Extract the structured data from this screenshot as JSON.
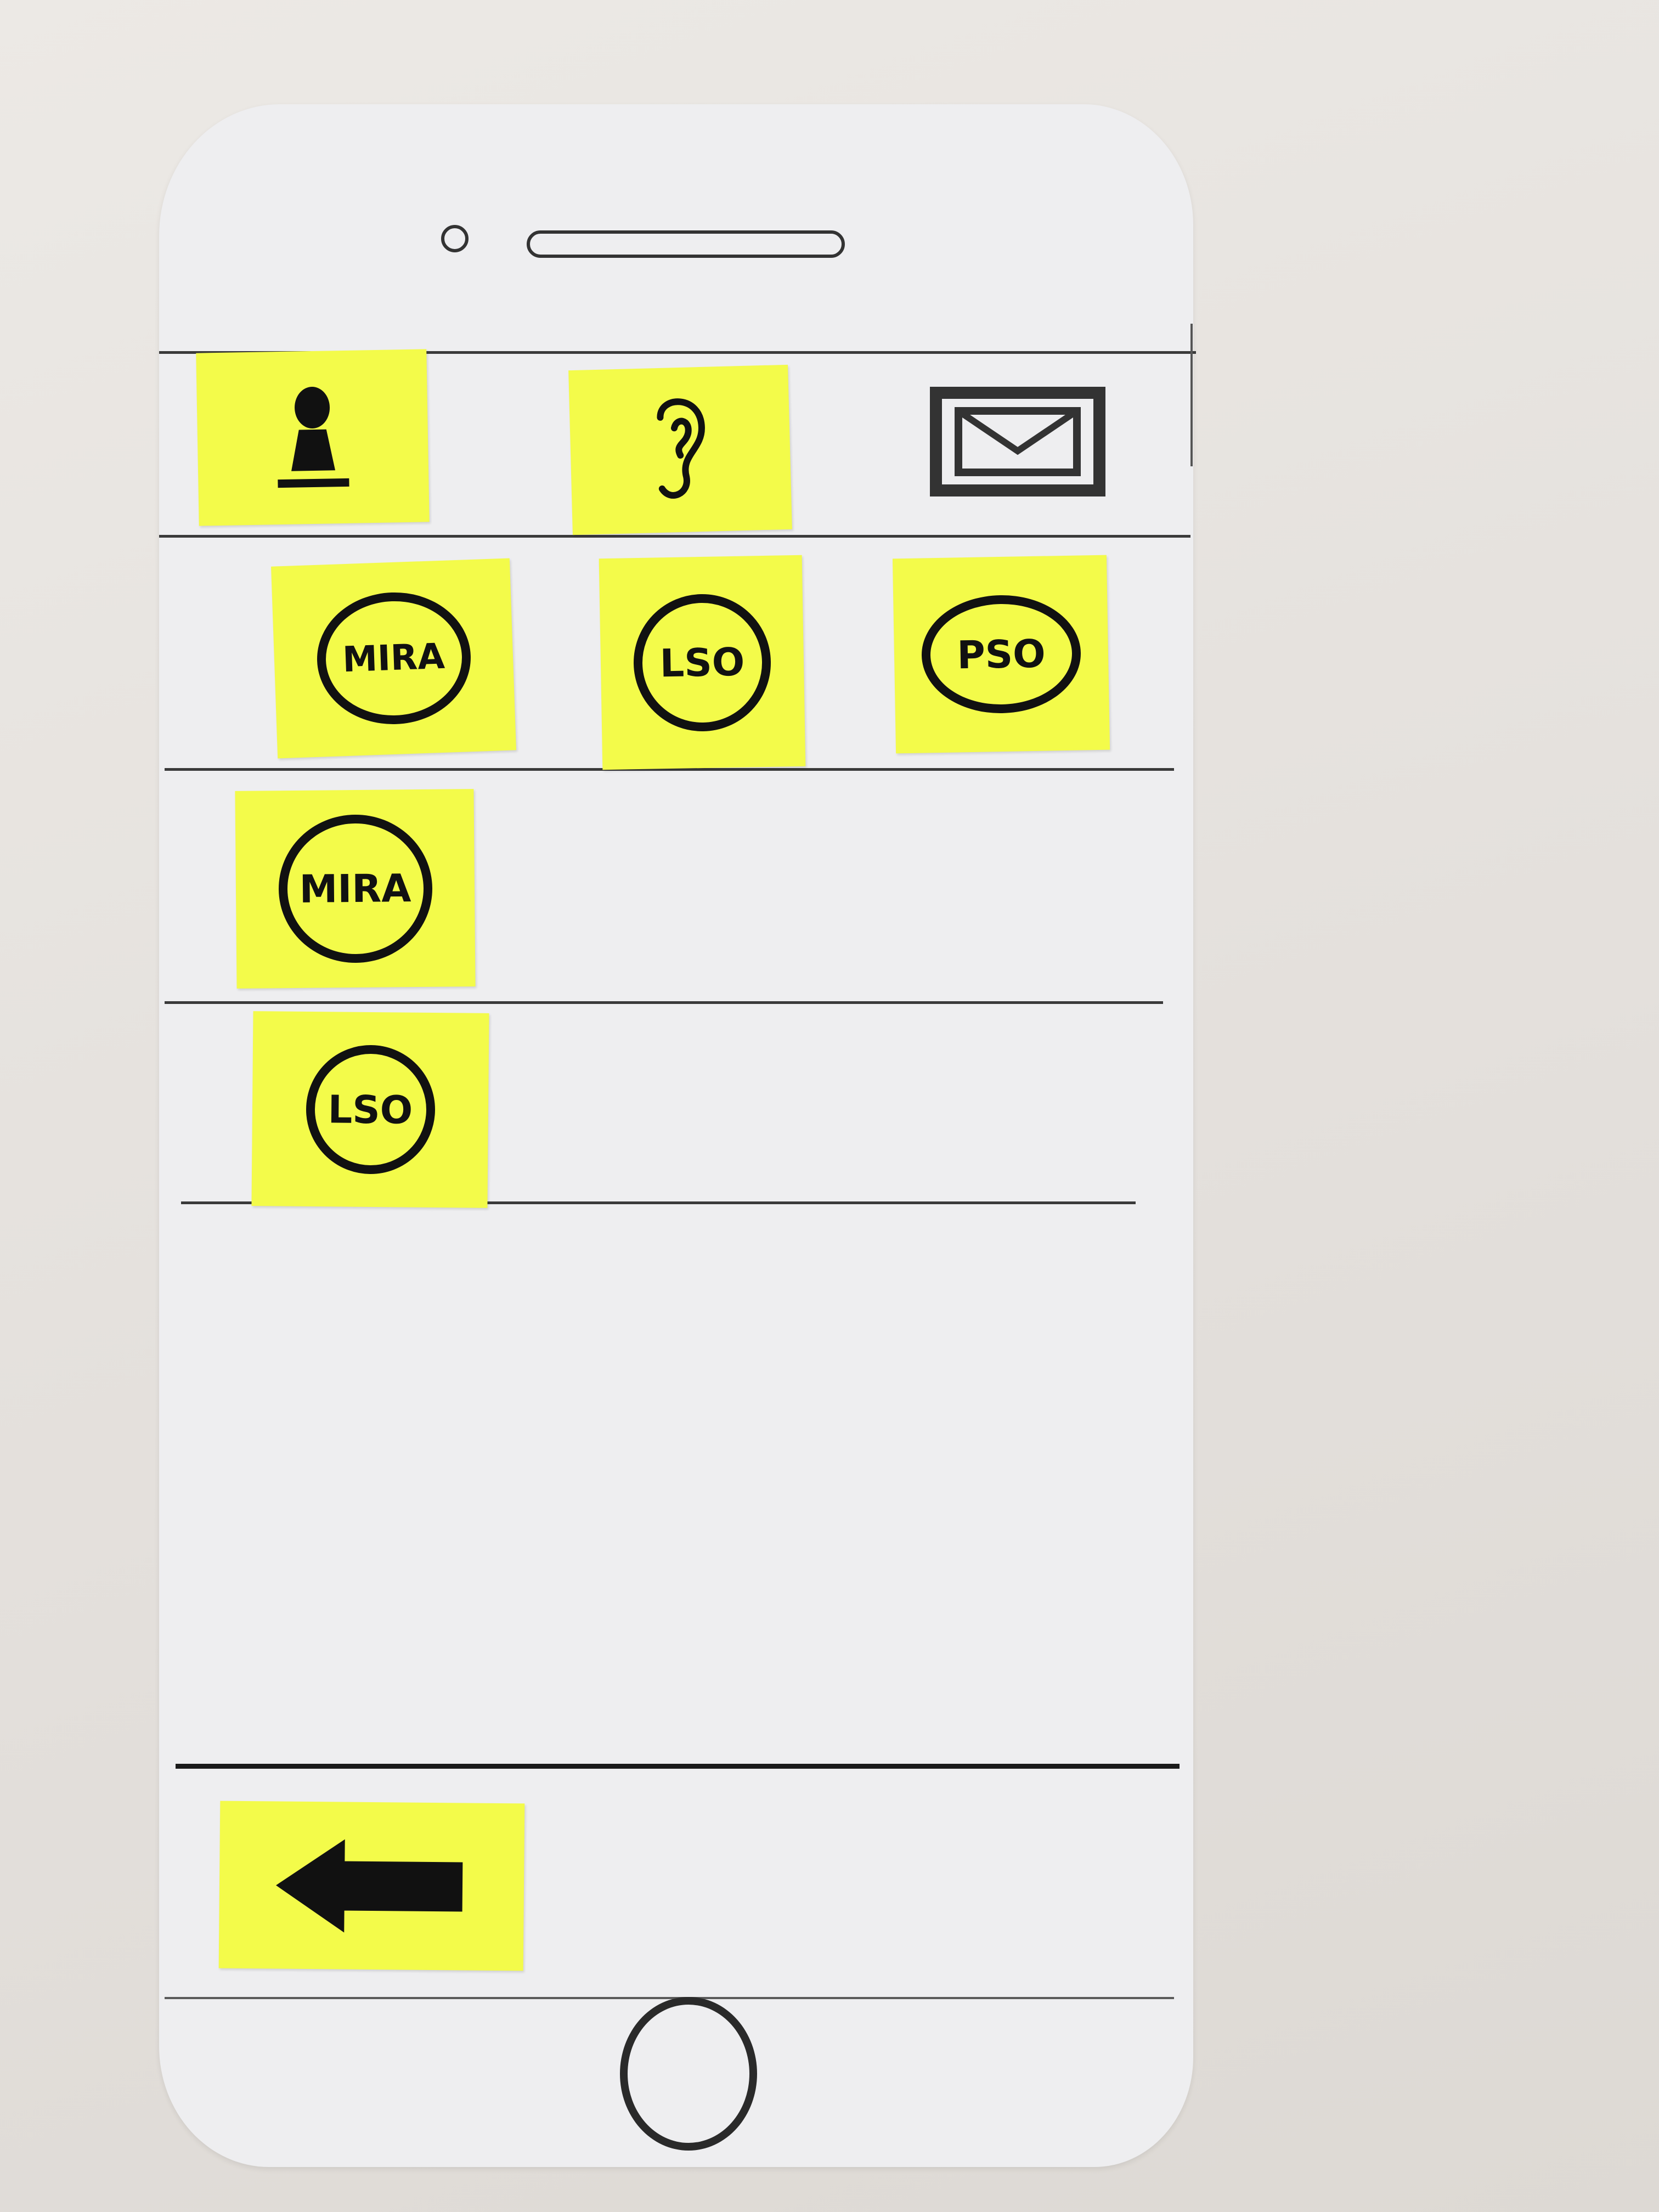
{
  "tabs": {
    "profile_icon": "person-icon",
    "ear_icon": "ear-icon",
    "mail_icon": "mail-icon"
  },
  "top_row": [
    {
      "label": "MIRA"
    },
    {
      "label": "LSO"
    },
    {
      "label": "PSO"
    }
  ],
  "list": [
    {
      "label": "MIRA"
    },
    {
      "label": "LSO"
    }
  ],
  "bottom_bar": {
    "back_icon": "back-arrow-icon"
  },
  "colors": {
    "sticky_note": "#f3fb4a",
    "paper": "#eeeef0",
    "ink": "#111111"
  }
}
